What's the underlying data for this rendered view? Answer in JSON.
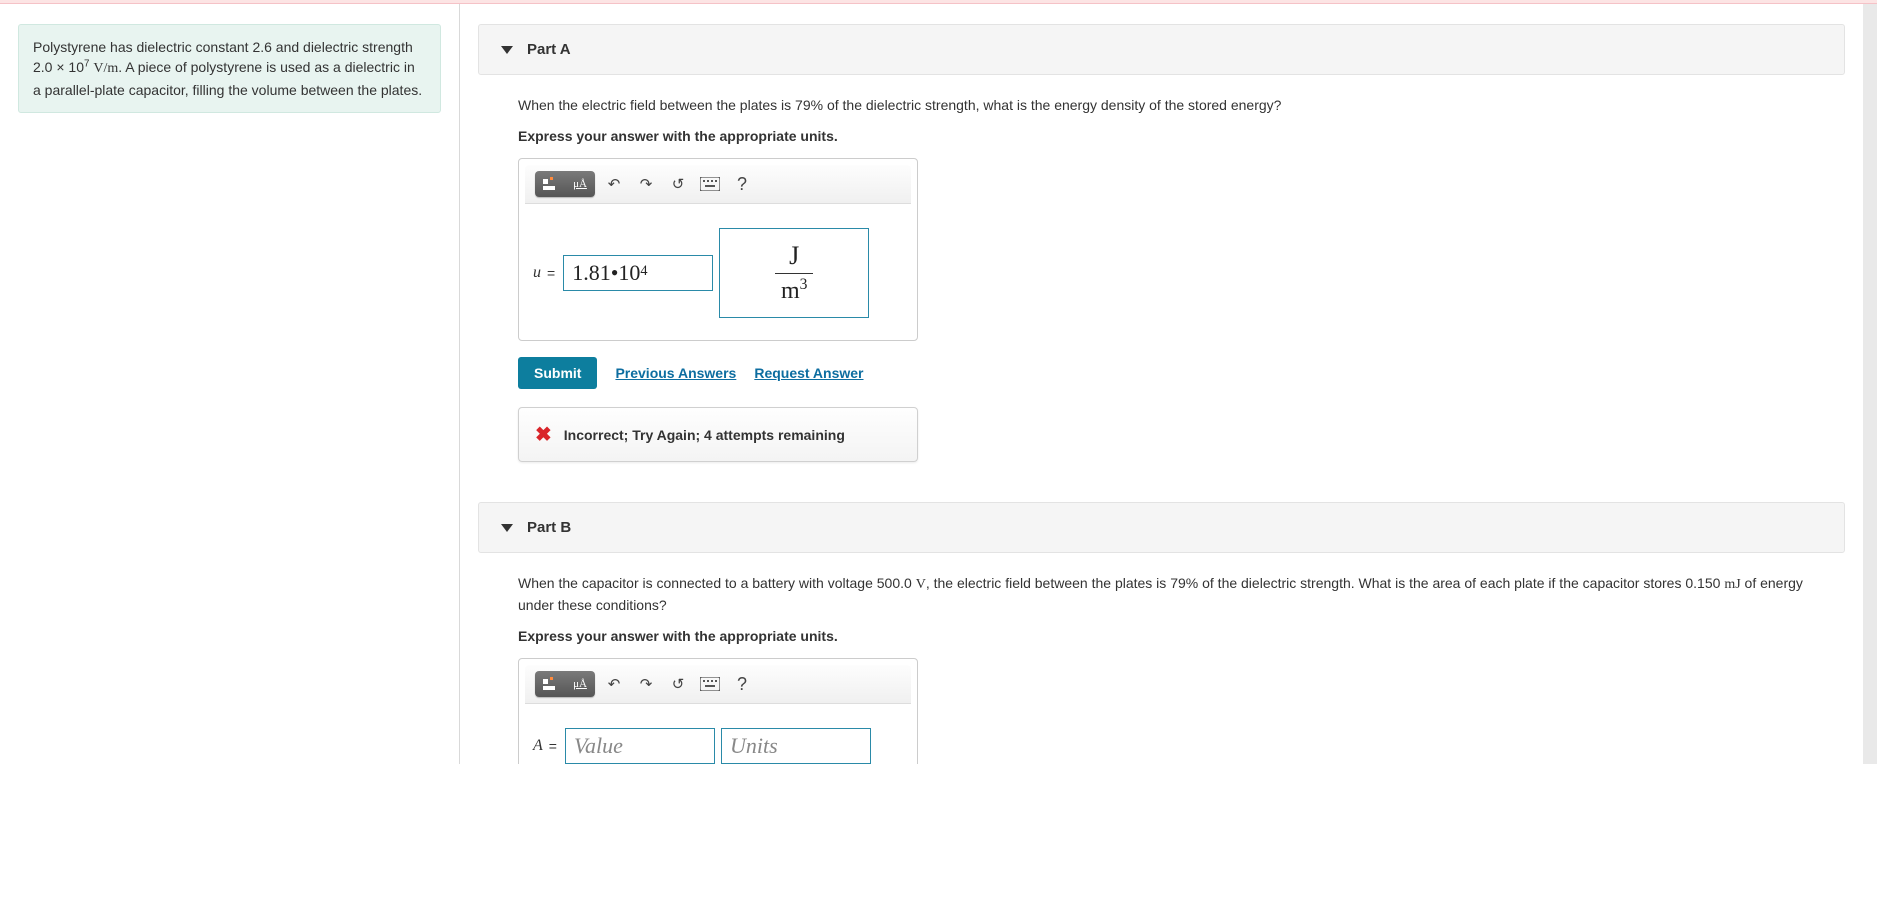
{
  "problem": {
    "text_pre": "Polystyrene has dielectric constant 2.6 and dielectric strength ",
    "strength_coeff": "2.0",
    "strength_exp": "7",
    "strength_units": "V/m",
    "text_post": ". A piece of polystyrene is used as a dielectric in a parallel-plate capacitor, filling the volume between the plates."
  },
  "partA": {
    "label": "Part A",
    "prompt_pre": "When the electric field between the plates is ",
    "percent": "79",
    "prompt_post": " of the dielectric strength, what is the energy density of the stored energy?",
    "instruction": "Express your answer with the appropriate units.",
    "var": "u",
    "value_mantissa": "1.81",
    "value_dot": " • ",
    "value_base": "10",
    "value_exp": "4",
    "unit_num": "J",
    "unit_den_base": "m",
    "unit_den_exp": "3",
    "submit": "Submit",
    "previous": "Previous Answers",
    "request": "Request Answer",
    "feedback": "Incorrect; Try Again; 4 attempts remaining"
  },
  "partB": {
    "label": "Part B",
    "prompt_1": "When the capacitor is connected to a battery with voltage ",
    "voltage": "500.0",
    "voltage_unit": "V",
    "prompt_2": ", the electric field between the plates is ",
    "percent": "79",
    "prompt_3": " of the dielectric strength. What is the area of each plate if the capacitor stores ",
    "energy": "0.150",
    "energy_unit": "mJ",
    "prompt_4": " of energy under these conditions?",
    "instruction": "Express your answer with the appropriate units.",
    "var": "A",
    "value_placeholder": "Value",
    "units_placeholder": "Units"
  },
  "toolbar": {
    "units_label": "μÅ",
    "help": "?"
  }
}
